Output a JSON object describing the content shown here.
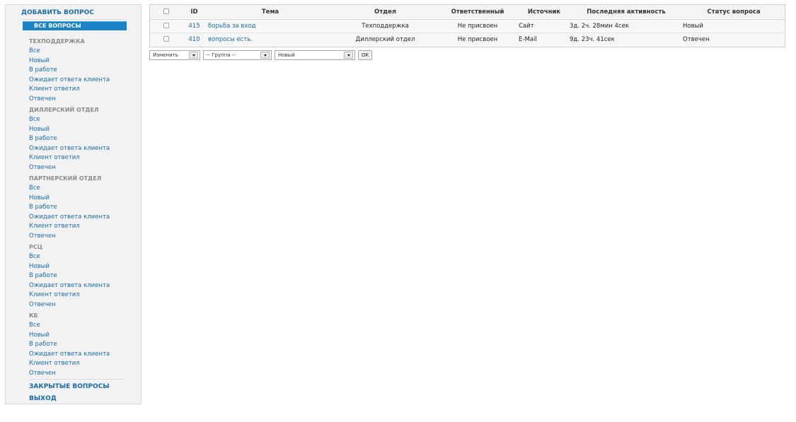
{
  "sidebar": {
    "add_question": "Добавить вопрос",
    "all_questions": "Все вопросы",
    "groups": [
      {
        "title": "Техподдержка",
        "items": [
          "Все",
          "Новый",
          "В работе",
          "Ожидает ответа клиента",
          "Клиент ответил",
          "Отвечен"
        ]
      },
      {
        "title": "Диллерский отдел",
        "items": [
          "Все",
          "Новый",
          "В работе",
          "Ожидает ответа клиента",
          "Клиент ответил",
          "Отвечен"
        ]
      },
      {
        "title": "Партнерский отдел",
        "items": [
          "Все",
          "Новый",
          "В работе",
          "Ожидает ответа клиента",
          "Клиент ответил",
          "Отвечен"
        ]
      },
      {
        "title": "РСЦ",
        "items": [
          "Все",
          "Новый",
          "В работе",
          "Ожидает ответа клиента",
          "Клиент ответил",
          "Отвечен"
        ]
      },
      {
        "title": "КБ",
        "items": [
          "Все",
          "Новый",
          "В работе",
          "Ожидает ответа клиента",
          "Клиент ответил",
          "Отвечен"
        ]
      }
    ],
    "closed_questions": "Закрытые вопросы",
    "logout": "Выход"
  },
  "table": {
    "headers": {
      "id": "ID",
      "topic": "Тема",
      "department": "Отдел",
      "responsible": "Ответственный",
      "source": "Источник",
      "last_activity": "Последняя активность",
      "status": "Статус вопроса"
    },
    "rows": [
      {
        "id": "415",
        "topic": "борьба за вход",
        "department": "Техподдержка",
        "responsible": "Не присвоен",
        "source": "Сайт",
        "last_activity": "3д. 2ч. 28мин 4сек",
        "status": "Новый"
      },
      {
        "id": "410",
        "topic": "вопросы есть.",
        "department": "Диллерский отдел",
        "responsible": "Не присвоен",
        "source": "E-Mail",
        "last_activity": "9д. 23ч. 41сек",
        "status": "Отвечен"
      }
    ]
  },
  "actions": {
    "action_select": "Изменить",
    "group_select": "-- Группа --",
    "status_select": "Новый",
    "ok_label": "OK"
  }
}
